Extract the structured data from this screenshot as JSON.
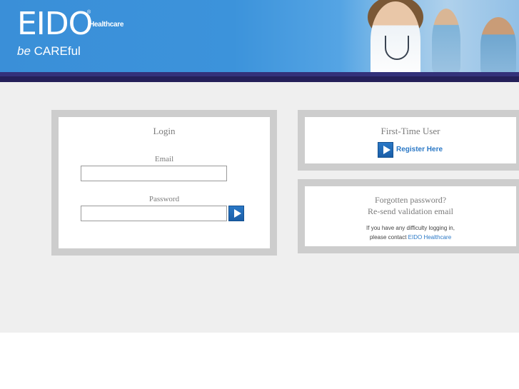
{
  "header": {
    "logo_text": "EIDO",
    "logo_registered": "®",
    "logo_subtitle": "Healthcare",
    "tagline_prefix": "be",
    "tagline_rest": " CAREful"
  },
  "login": {
    "title": "Login",
    "email_label": "Email",
    "email_value": "",
    "password_label": "Password",
    "password_value": ""
  },
  "first_time": {
    "title": "First-Time User",
    "register_label": "Register Here"
  },
  "forgot": {
    "forgotten_password": "Forgotten password?",
    "resend_validation": "Re-send validation email",
    "help_line1": "If you have any difficulty logging in,",
    "help_line2_prefix": "please contact ",
    "contact_link": "EIDO Healthcare"
  },
  "colors": {
    "header_blue": "#3c93db",
    "nav_dark": "#242059",
    "panel_border": "#cdcdcd",
    "link_blue": "#2a78c6",
    "background": "#efefef"
  }
}
